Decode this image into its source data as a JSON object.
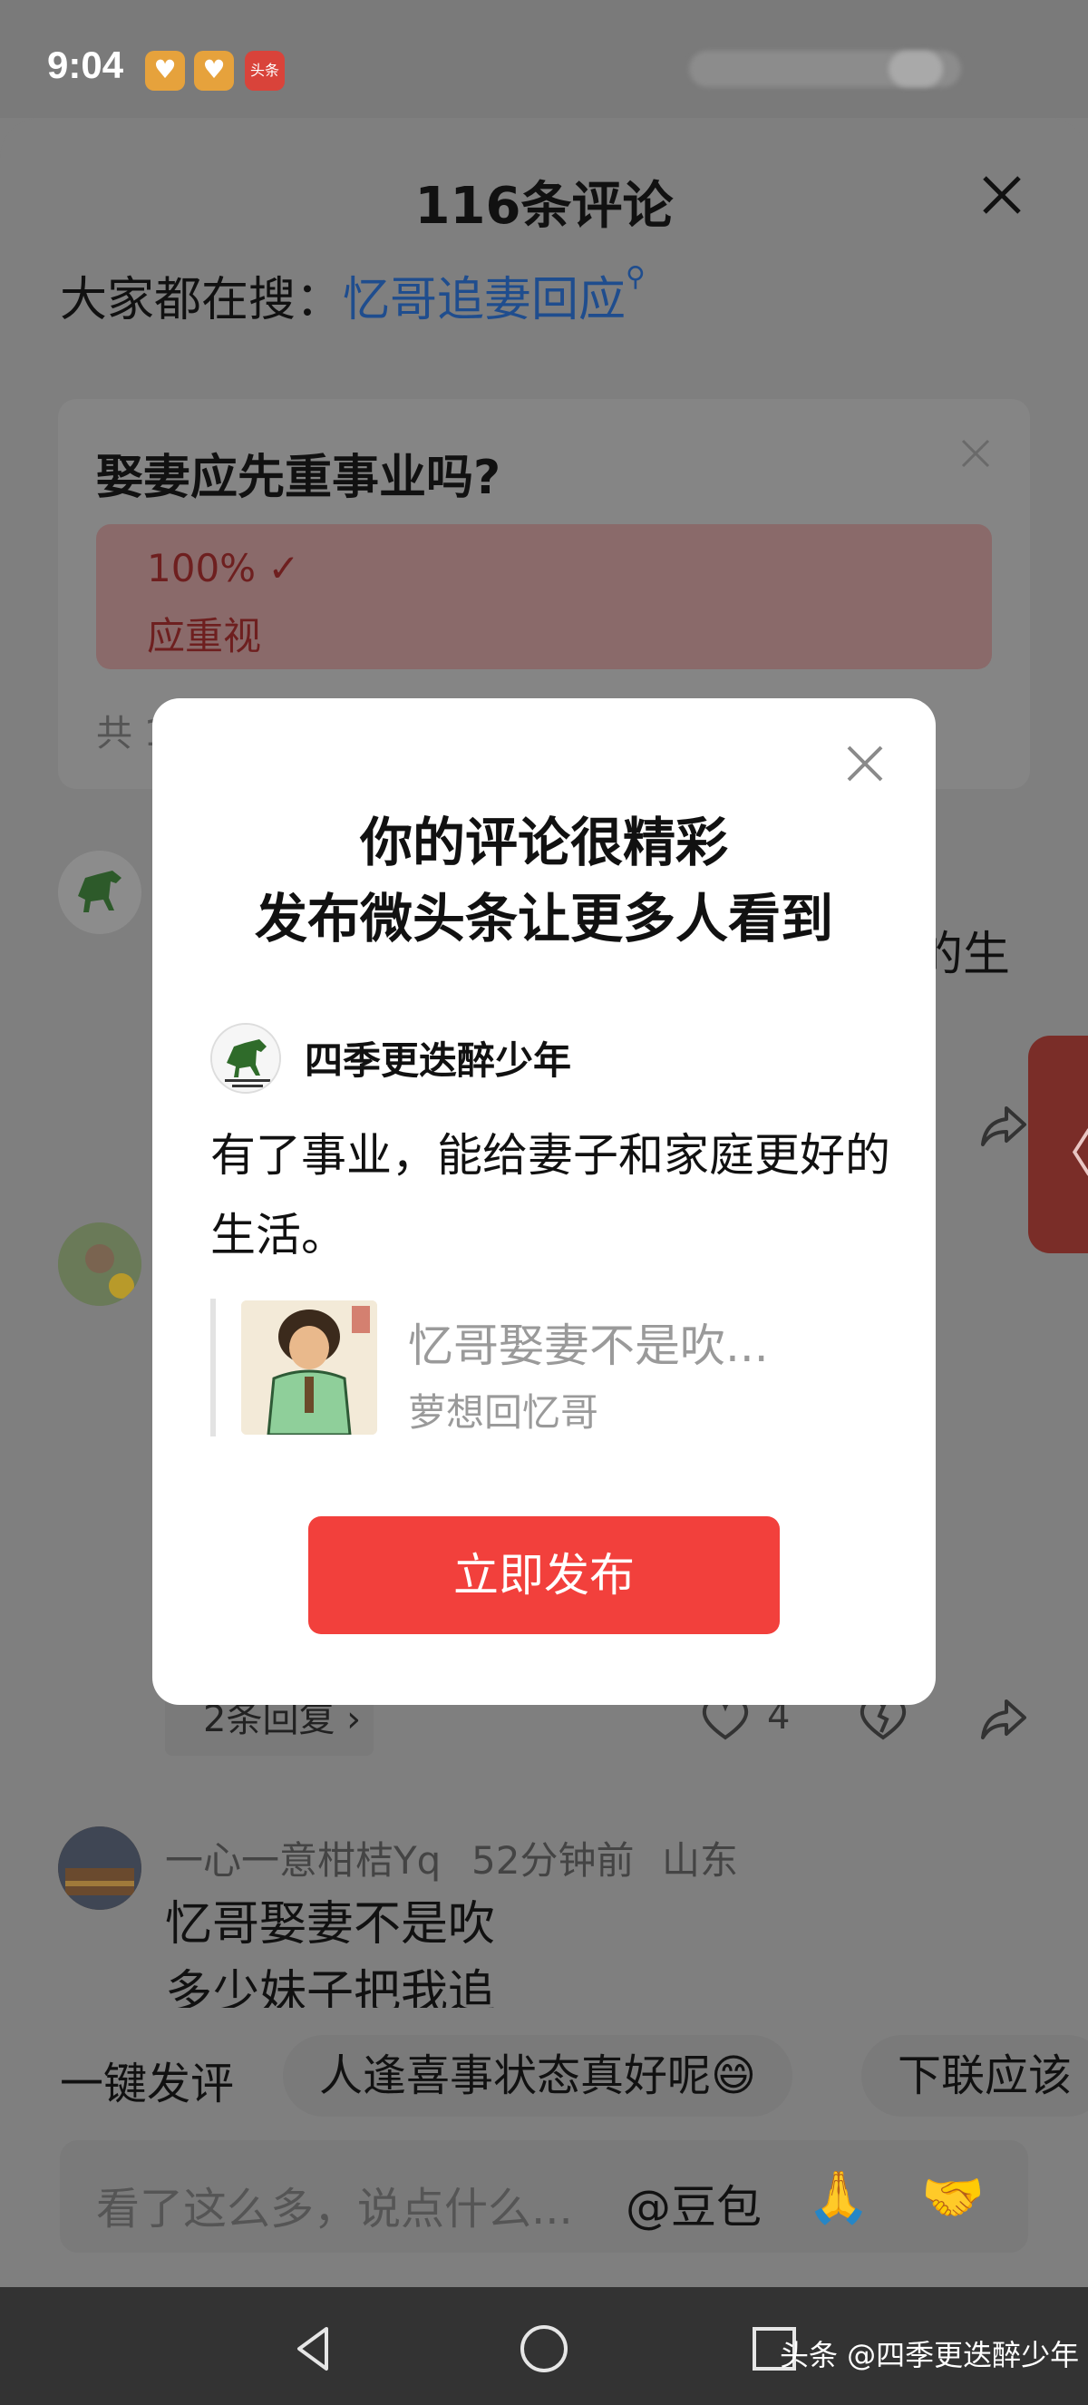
{
  "status_bar": {
    "time": "9:04",
    "toutiao_badge": "头条"
  },
  "sheet": {
    "title": "116条评论",
    "search_prefix": "大家都在搜：",
    "search_term": "忆哥追妻回应"
  },
  "poll": {
    "question": "娶妻应先重事业吗?",
    "percent": "100% ✓",
    "option": "应重视",
    "total_prefix": "共 1"
  },
  "comments": [
    {
      "fragment_right": "的生"
    },
    {
      "reply_label": "2条回复 ›",
      "likes": "4"
    },
    {
      "author": "一心一意柑桔Yq",
      "time": "52分钟前",
      "location": "山东",
      "lines": [
        "忆哥娶妻不是吹",
        "多少妹子把我追"
      ]
    }
  ],
  "side_tab": {
    "arrow": "〈"
  },
  "quick_reply": {
    "label": "一键发评",
    "chips": [
      "人逢喜事状态真好呢😄",
      "下联应该"
    ]
  },
  "input": {
    "placeholder": "看了这么多，说点什么...",
    "at_label": "@豆包",
    "emoji_1": "🙏",
    "emoji_2": "🤝"
  },
  "nav": {
    "watermark": "头条 @四季更迭醉少年"
  },
  "modal": {
    "title_line1": "你的评论很精彩",
    "title_line2": "发布微头条让更多人看到",
    "author": "四季更迭醉少年",
    "post_text": "有了事业，能给妻子和家庭更好的生活。",
    "quote_title": "忆哥娶妻不是吹...",
    "quote_source": "萝想回忆哥",
    "publish_label": "立即发布"
  },
  "colors": {
    "accent_red": "#f2403c",
    "link_blue": "#1f4d8e",
    "dim_overlay": "#7f7f7f"
  }
}
